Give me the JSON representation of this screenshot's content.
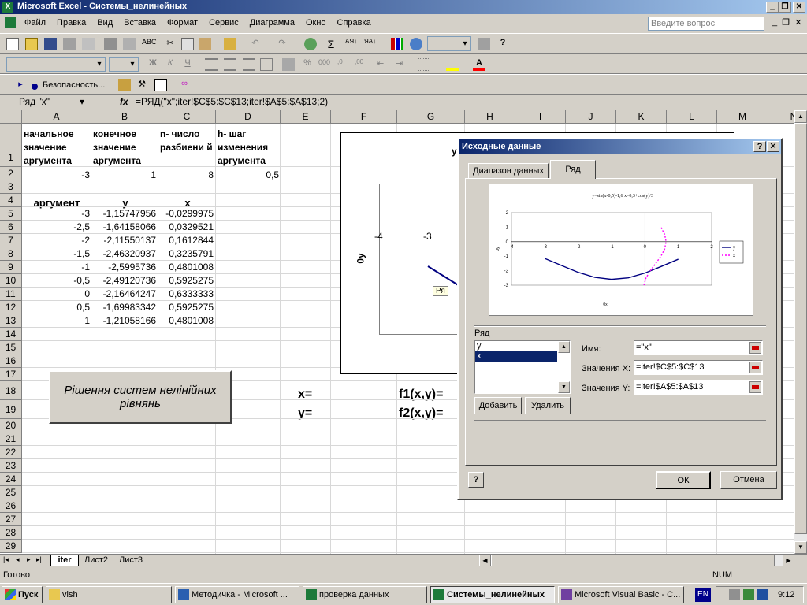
{
  "window": {
    "title": "Microsoft Excel - Системы_нелинейных"
  },
  "menu": {
    "items": [
      "Файл",
      "Правка",
      "Вид",
      "Вставка",
      "Формат",
      "Сервис",
      "Диаграмма",
      "Окно",
      "Справка"
    ],
    "help_placeholder": "Введите вопрос"
  },
  "toolbar": {
    "security_label": "Безопасность..."
  },
  "formula_bar": {
    "name_box": "Ряд \"x\"",
    "fx": "fx",
    "formula": "=РЯД(\"x\";iter!$C$5:$C$13;iter!$A$5:$A$13;2)"
  },
  "columns": [
    "A",
    "B",
    "C",
    "D",
    "E",
    "F",
    "G",
    "H",
    "I",
    "J",
    "K",
    "L",
    "M",
    "N"
  ],
  "rows": [
    "1",
    "2",
    "3",
    "4",
    "5",
    "6",
    "7",
    "8",
    "9",
    "10",
    "11",
    "12",
    "13",
    "14",
    "15",
    "16",
    "17",
    "18",
    "19",
    "20",
    "21",
    "22",
    "23",
    "24",
    "25",
    "26",
    "27",
    "28",
    "29"
  ],
  "headers": {
    "a1": "начальное значение аргумента",
    "b1": "конечное значение аргумента",
    "c1": "n- число разбиени й",
    "d1": "h- шаг изменения аргумента"
  },
  "row2": {
    "a": "-3",
    "b": "1",
    "c": "8",
    "d": "0,5"
  },
  "row4": {
    "a": "аргумент",
    "b": "y",
    "c": "x"
  },
  "table": [
    [
      "-3",
      "-1,15747956",
      "-0,0299975"
    ],
    [
      "-2,5",
      "-1,64158066",
      "0,0329521"
    ],
    [
      "-2",
      "-2,11550137",
      "0,1612844"
    ],
    [
      "-1,5",
      "-2,46320937",
      "0,3235791"
    ],
    [
      "-1",
      "-2,5995736",
      "0,4801008"
    ],
    [
      "-0,5",
      "-2,49120736",
      "0,5925275"
    ],
    [
      "0",
      "-2,16464247",
      "0,6333333"
    ],
    [
      "0,5",
      "-1,69983342",
      "0,5925275"
    ],
    [
      "1",
      "-1,21058166",
      "0,4801008"
    ]
  ],
  "macro_button": "Рішення систем нелінійних рівнянь",
  "labels": {
    "x_eq": "x=",
    "y_eq": "y=",
    "f1": "f1(x,y)=",
    "f2": "f2(x,y)="
  },
  "embedded_chart": {
    "title_fragment": "y=",
    "axis_label": "0y",
    "x_ticks": [
      "-4",
      "-3"
    ],
    "tag": "Ря"
  },
  "sheet_tabs": [
    "iter",
    "Лист2",
    "Лист3"
  ],
  "status": {
    "ready": "Готово",
    "num": "NUM"
  },
  "dialog": {
    "title": "Исходные данные",
    "tabs": [
      "Диапазон данных",
      "Ряд"
    ],
    "series_label": "Ряд",
    "series_list": [
      "y",
      "x"
    ],
    "add_button": "Добавить",
    "remove_button": "Удалить",
    "name_label": "Имя:",
    "name_value": "=\"x\"",
    "xvalues_label": "Значения X:",
    "xvalues_value": "=iter!$C$5:$C$13",
    "yvalues_label": "Значения Y:",
    "yvalues_value": "=iter!$A$5:$A$13",
    "ok": "ОК",
    "cancel": "Отмена",
    "help": "?",
    "close": "✕"
  },
  "chart_data": {
    "type": "scatter",
    "title": "y=sin(x-0,5)-1,6       x=0,3+cos(y)/3",
    "xlabel": "0x",
    "ylabel": "0y",
    "xlim": [
      -4,
      2
    ],
    "ylim": [
      -3,
      2
    ],
    "x_ticks": [
      "-4",
      "-3",
      "-2",
      "-1",
      "0",
      "1",
      "2"
    ],
    "y_ticks": [
      "2",
      "1",
      "0",
      "-1",
      "-2",
      "-3"
    ],
    "legend": "right",
    "series": [
      {
        "name": "y",
        "color": "#000080",
        "x": [
          -3,
          -2.5,
          -2,
          -1.5,
          -1,
          -0.5,
          0,
          0.5,
          1
        ],
        "y": [
          -1.15747956,
          -1.64158066,
          -2.11550137,
          -2.46320937,
          -2.5995736,
          -2.49120736,
          -2.16464247,
          -1.69983342,
          -1.21058166
        ]
      },
      {
        "name": "x",
        "color": "#ff00ff",
        "x": [
          -0.0299975,
          0.0329521,
          0.1612844,
          0.3235791,
          0.4801008,
          0.5925275,
          0.6333333,
          0.5925275,
          0.4801008
        ],
        "y": [
          -3,
          -2.5,
          -2,
          -1.5,
          -1,
          -0.5,
          0,
          0.5,
          1
        ]
      }
    ]
  },
  "taskbar": {
    "start": "Пуск",
    "tasks": [
      "vish",
      "Методичка - Microsoft ...",
      "проверка данных",
      "Системы_нелинейных",
      "Microsoft Visual Basic - C..."
    ],
    "lang": "EN",
    "clock": "9:12"
  }
}
